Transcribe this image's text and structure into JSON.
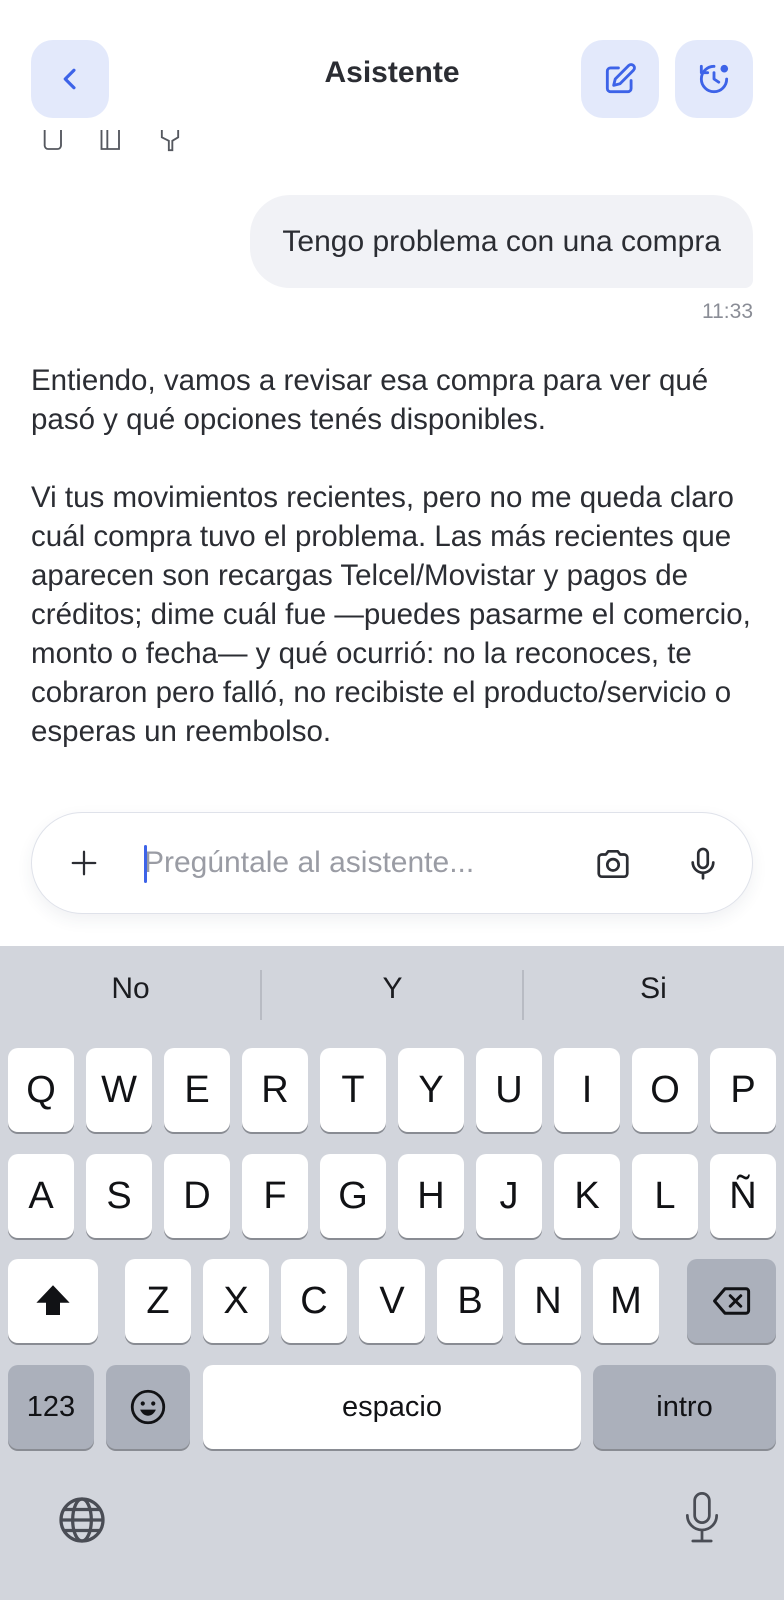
{
  "header": {
    "title": "Asistente"
  },
  "conversation": {
    "user_message": "Tengo problema con una compra",
    "user_time": "11:33",
    "assistant_paragraphs": [
      "Entiendo, vamos a revisar esa compra para ver qué pasó y qué opciones tenés disponibles.",
      "Vi tus movimientos recientes, pero no me queda claro cuál compra tuvo el problema. Las más recientes que aparecen son recargas Telcel/Movistar y pagos de créditos; dime cuál fue —puedes pasarme el comercio, monto o fecha— y qué ocurrió: no la reconoces, te cobraron pero falló, no recibiste el producto/servicio o esperas un reembolso."
    ]
  },
  "composer": {
    "placeholder": "Pregúntale al asistente...",
    "value": ""
  },
  "keyboard": {
    "suggestions": [
      "No",
      "Y",
      "Si"
    ],
    "row1": [
      "Q",
      "W",
      "E",
      "R",
      "T",
      "Y",
      "U",
      "I",
      "O",
      "P"
    ],
    "row2": [
      "A",
      "S",
      "D",
      "F",
      "G",
      "H",
      "J",
      "K",
      "L",
      "Ñ"
    ],
    "row3": [
      "Z",
      "X",
      "C",
      "V",
      "B",
      "N",
      "M"
    ],
    "numbers_label": "123",
    "space_label": "espacio",
    "return_label": "intro"
  },
  "colors": {
    "accent": "#3d63e8",
    "header_button_bg": "#e3e9fb",
    "bubble_bg": "#f1f2f6",
    "keyboard_bg": "#d2d5dc"
  },
  "icons": [
    "chevron-left-icon",
    "edit-icon",
    "history-icon",
    "plus-icon",
    "camera-icon",
    "microphone-icon",
    "shift-icon",
    "backspace-icon",
    "emoji-icon",
    "globe-icon",
    "dictation-icon"
  ]
}
